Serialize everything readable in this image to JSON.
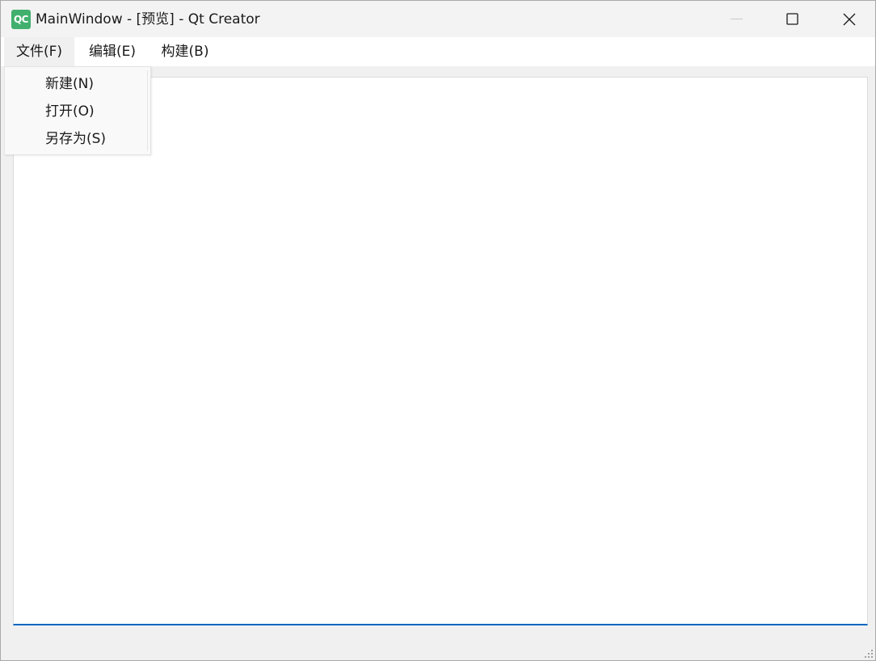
{
  "window": {
    "title": "MainWindow - [预览] - Qt Creator",
    "logo_text": "QC",
    "logo_color": "#41b06e"
  },
  "titlebar_buttons": {
    "minimize_icon": "minimize-icon",
    "maximize_icon": "maximize-icon",
    "close_icon": "close-icon"
  },
  "menubar": {
    "items": [
      {
        "label": "文件(F)"
      },
      {
        "label": "编辑(E)"
      },
      {
        "label": "构建(B)"
      }
    ]
  },
  "file_menu": {
    "items": [
      {
        "label": "新建(N)"
      },
      {
        "label": "打开(O)"
      },
      {
        "label": "另存为(S)"
      }
    ]
  },
  "colors": {
    "accent": "#0067c0",
    "menu_background": "#f9f9f9",
    "window_background": "#f0f0f0"
  }
}
